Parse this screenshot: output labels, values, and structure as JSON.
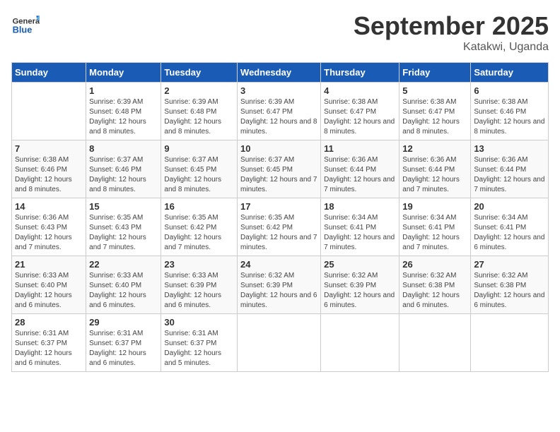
{
  "header": {
    "logo_general": "General",
    "logo_blue": "Blue",
    "month_title": "September 2025",
    "subtitle": "Katakwi, Uganda"
  },
  "days_of_week": [
    "Sunday",
    "Monday",
    "Tuesday",
    "Wednesday",
    "Thursday",
    "Friday",
    "Saturday"
  ],
  "weeks": [
    [
      {
        "day": "",
        "sunrise": "",
        "sunset": "",
        "daylight": ""
      },
      {
        "day": "1",
        "sunrise": "Sunrise: 6:39 AM",
        "sunset": "Sunset: 6:48 PM",
        "daylight": "Daylight: 12 hours and 8 minutes."
      },
      {
        "day": "2",
        "sunrise": "Sunrise: 6:39 AM",
        "sunset": "Sunset: 6:48 PM",
        "daylight": "Daylight: 12 hours and 8 minutes."
      },
      {
        "day": "3",
        "sunrise": "Sunrise: 6:39 AM",
        "sunset": "Sunset: 6:47 PM",
        "daylight": "Daylight: 12 hours and 8 minutes."
      },
      {
        "day": "4",
        "sunrise": "Sunrise: 6:38 AM",
        "sunset": "Sunset: 6:47 PM",
        "daylight": "Daylight: 12 hours and 8 minutes."
      },
      {
        "day": "5",
        "sunrise": "Sunrise: 6:38 AM",
        "sunset": "Sunset: 6:47 PM",
        "daylight": "Daylight: 12 hours and 8 minutes."
      },
      {
        "day": "6",
        "sunrise": "Sunrise: 6:38 AM",
        "sunset": "Sunset: 6:46 PM",
        "daylight": "Daylight: 12 hours and 8 minutes."
      }
    ],
    [
      {
        "day": "7",
        "sunrise": "Sunrise: 6:38 AM",
        "sunset": "Sunset: 6:46 PM",
        "daylight": "Daylight: 12 hours and 8 minutes."
      },
      {
        "day": "8",
        "sunrise": "Sunrise: 6:37 AM",
        "sunset": "Sunset: 6:46 PM",
        "daylight": "Daylight: 12 hours and 8 minutes."
      },
      {
        "day": "9",
        "sunrise": "Sunrise: 6:37 AM",
        "sunset": "Sunset: 6:45 PM",
        "daylight": "Daylight: 12 hours and 8 minutes."
      },
      {
        "day": "10",
        "sunrise": "Sunrise: 6:37 AM",
        "sunset": "Sunset: 6:45 PM",
        "daylight": "Daylight: 12 hours and 7 minutes."
      },
      {
        "day": "11",
        "sunrise": "Sunrise: 6:36 AM",
        "sunset": "Sunset: 6:44 PM",
        "daylight": "Daylight: 12 hours and 7 minutes."
      },
      {
        "day": "12",
        "sunrise": "Sunrise: 6:36 AM",
        "sunset": "Sunset: 6:44 PM",
        "daylight": "Daylight: 12 hours and 7 minutes."
      },
      {
        "day": "13",
        "sunrise": "Sunrise: 6:36 AM",
        "sunset": "Sunset: 6:44 PM",
        "daylight": "Daylight: 12 hours and 7 minutes."
      }
    ],
    [
      {
        "day": "14",
        "sunrise": "Sunrise: 6:36 AM",
        "sunset": "Sunset: 6:43 PM",
        "daylight": "Daylight: 12 hours and 7 minutes."
      },
      {
        "day": "15",
        "sunrise": "Sunrise: 6:35 AM",
        "sunset": "Sunset: 6:43 PM",
        "daylight": "Daylight: 12 hours and 7 minutes."
      },
      {
        "day": "16",
        "sunrise": "Sunrise: 6:35 AM",
        "sunset": "Sunset: 6:42 PM",
        "daylight": "Daylight: 12 hours and 7 minutes."
      },
      {
        "day": "17",
        "sunrise": "Sunrise: 6:35 AM",
        "sunset": "Sunset: 6:42 PM",
        "daylight": "Daylight: 12 hours and 7 minutes."
      },
      {
        "day": "18",
        "sunrise": "Sunrise: 6:34 AM",
        "sunset": "Sunset: 6:41 PM",
        "daylight": "Daylight: 12 hours and 7 minutes."
      },
      {
        "day": "19",
        "sunrise": "Sunrise: 6:34 AM",
        "sunset": "Sunset: 6:41 PM",
        "daylight": "Daylight: 12 hours and 7 minutes."
      },
      {
        "day": "20",
        "sunrise": "Sunrise: 6:34 AM",
        "sunset": "Sunset: 6:41 PM",
        "daylight": "Daylight: 12 hours and 6 minutes."
      }
    ],
    [
      {
        "day": "21",
        "sunrise": "Sunrise: 6:33 AM",
        "sunset": "Sunset: 6:40 PM",
        "daylight": "Daylight: 12 hours and 6 minutes."
      },
      {
        "day": "22",
        "sunrise": "Sunrise: 6:33 AM",
        "sunset": "Sunset: 6:40 PM",
        "daylight": "Daylight: 12 hours and 6 minutes."
      },
      {
        "day": "23",
        "sunrise": "Sunrise: 6:33 AM",
        "sunset": "Sunset: 6:39 PM",
        "daylight": "Daylight: 12 hours and 6 minutes."
      },
      {
        "day": "24",
        "sunrise": "Sunrise: 6:32 AM",
        "sunset": "Sunset: 6:39 PM",
        "daylight": "Daylight: 12 hours and 6 minutes."
      },
      {
        "day": "25",
        "sunrise": "Sunrise: 6:32 AM",
        "sunset": "Sunset: 6:39 PM",
        "daylight": "Daylight: 12 hours and 6 minutes."
      },
      {
        "day": "26",
        "sunrise": "Sunrise: 6:32 AM",
        "sunset": "Sunset: 6:38 PM",
        "daylight": "Daylight: 12 hours and 6 minutes."
      },
      {
        "day": "27",
        "sunrise": "Sunrise: 6:32 AM",
        "sunset": "Sunset: 6:38 PM",
        "daylight": "Daylight: 12 hours and 6 minutes."
      }
    ],
    [
      {
        "day": "28",
        "sunrise": "Sunrise: 6:31 AM",
        "sunset": "Sunset: 6:37 PM",
        "daylight": "Daylight: 12 hours and 6 minutes."
      },
      {
        "day": "29",
        "sunrise": "Sunrise: 6:31 AM",
        "sunset": "Sunset: 6:37 PM",
        "daylight": "Daylight: 12 hours and 6 minutes."
      },
      {
        "day": "30",
        "sunrise": "Sunrise: 6:31 AM",
        "sunset": "Sunset: 6:37 PM",
        "daylight": "Daylight: 12 hours and 5 minutes."
      },
      {
        "day": "",
        "sunrise": "",
        "sunset": "",
        "daylight": ""
      },
      {
        "day": "",
        "sunrise": "",
        "sunset": "",
        "daylight": ""
      },
      {
        "day": "",
        "sunrise": "",
        "sunset": "",
        "daylight": ""
      },
      {
        "day": "",
        "sunrise": "",
        "sunset": "",
        "daylight": ""
      }
    ]
  ]
}
